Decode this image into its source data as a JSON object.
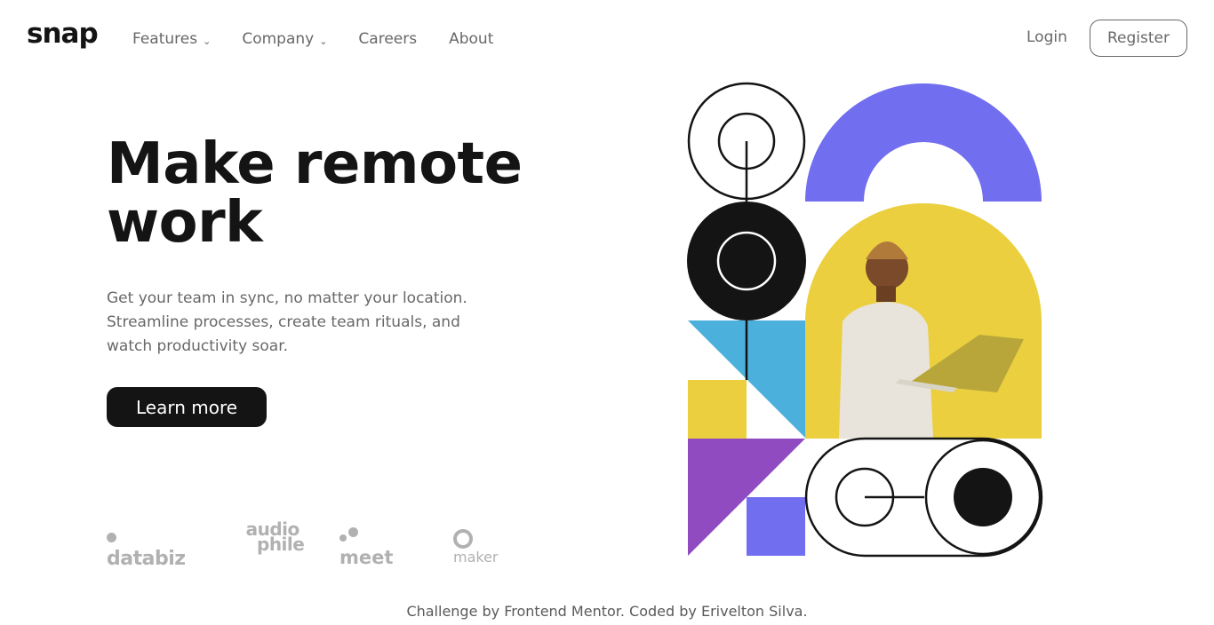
{
  "brand": {
    "logo": "snap"
  },
  "nav": {
    "items": [
      {
        "label": "Features",
        "has_dropdown": true
      },
      {
        "label": "Company",
        "has_dropdown": true
      },
      {
        "label": "Careers",
        "has_dropdown": false
      },
      {
        "label": "About",
        "has_dropdown": false
      }
    ],
    "login": "Login",
    "register": "Register"
  },
  "hero": {
    "title_line1": "Make remote",
    "title_line2": "work",
    "text_line1": "Get your team in sync, no matter your location.",
    "text_line2": "Streamline processes, create team rituals, and",
    "text_line3": "watch productivity soar.",
    "cta": "Learn more"
  },
  "clients": {
    "databiz": "databiz",
    "audiophile_1": "audio",
    "audiophile_2": "phile",
    "meet": "meet",
    "maker": "maker"
  },
  "icons": {
    "dropdown": "chevron-down-icon"
  },
  "colors": {
    "purple_blue": "#716EF0",
    "yellow": "#EBCF3F",
    "sky": "#4CB0DC",
    "violet": "#8F4BBF",
    "dark": "#141414"
  },
  "footer": "Challenge by Frontend Mentor. Coded by Erivelton Silva."
}
